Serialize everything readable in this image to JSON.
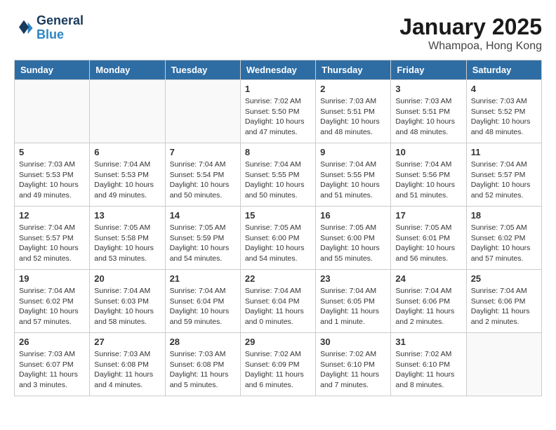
{
  "header": {
    "logo_line1": "General",
    "logo_line2": "Blue",
    "title": "January 2025",
    "subtitle": "Whampoa, Hong Kong"
  },
  "columns": [
    "Sunday",
    "Monday",
    "Tuesday",
    "Wednesday",
    "Thursday",
    "Friday",
    "Saturday"
  ],
  "weeks": [
    [
      {
        "day": "",
        "info": ""
      },
      {
        "day": "",
        "info": ""
      },
      {
        "day": "",
        "info": ""
      },
      {
        "day": "1",
        "info": "Sunrise: 7:02 AM\nSunset: 5:50 PM\nDaylight: 10 hours\nand 47 minutes."
      },
      {
        "day": "2",
        "info": "Sunrise: 7:03 AM\nSunset: 5:51 PM\nDaylight: 10 hours\nand 48 minutes."
      },
      {
        "day": "3",
        "info": "Sunrise: 7:03 AM\nSunset: 5:51 PM\nDaylight: 10 hours\nand 48 minutes."
      },
      {
        "day": "4",
        "info": "Sunrise: 7:03 AM\nSunset: 5:52 PM\nDaylight: 10 hours\nand 48 minutes."
      }
    ],
    [
      {
        "day": "5",
        "info": "Sunrise: 7:03 AM\nSunset: 5:53 PM\nDaylight: 10 hours\nand 49 minutes."
      },
      {
        "day": "6",
        "info": "Sunrise: 7:04 AM\nSunset: 5:53 PM\nDaylight: 10 hours\nand 49 minutes."
      },
      {
        "day": "7",
        "info": "Sunrise: 7:04 AM\nSunset: 5:54 PM\nDaylight: 10 hours\nand 50 minutes."
      },
      {
        "day": "8",
        "info": "Sunrise: 7:04 AM\nSunset: 5:55 PM\nDaylight: 10 hours\nand 50 minutes."
      },
      {
        "day": "9",
        "info": "Sunrise: 7:04 AM\nSunset: 5:55 PM\nDaylight: 10 hours\nand 51 minutes."
      },
      {
        "day": "10",
        "info": "Sunrise: 7:04 AM\nSunset: 5:56 PM\nDaylight: 10 hours\nand 51 minutes."
      },
      {
        "day": "11",
        "info": "Sunrise: 7:04 AM\nSunset: 5:57 PM\nDaylight: 10 hours\nand 52 minutes."
      }
    ],
    [
      {
        "day": "12",
        "info": "Sunrise: 7:04 AM\nSunset: 5:57 PM\nDaylight: 10 hours\nand 52 minutes."
      },
      {
        "day": "13",
        "info": "Sunrise: 7:05 AM\nSunset: 5:58 PM\nDaylight: 10 hours\nand 53 minutes."
      },
      {
        "day": "14",
        "info": "Sunrise: 7:05 AM\nSunset: 5:59 PM\nDaylight: 10 hours\nand 54 minutes."
      },
      {
        "day": "15",
        "info": "Sunrise: 7:05 AM\nSunset: 6:00 PM\nDaylight: 10 hours\nand 54 minutes."
      },
      {
        "day": "16",
        "info": "Sunrise: 7:05 AM\nSunset: 6:00 PM\nDaylight: 10 hours\nand 55 minutes."
      },
      {
        "day": "17",
        "info": "Sunrise: 7:05 AM\nSunset: 6:01 PM\nDaylight: 10 hours\nand 56 minutes."
      },
      {
        "day": "18",
        "info": "Sunrise: 7:05 AM\nSunset: 6:02 PM\nDaylight: 10 hours\nand 57 minutes."
      }
    ],
    [
      {
        "day": "19",
        "info": "Sunrise: 7:04 AM\nSunset: 6:02 PM\nDaylight: 10 hours\nand 57 minutes."
      },
      {
        "day": "20",
        "info": "Sunrise: 7:04 AM\nSunset: 6:03 PM\nDaylight: 10 hours\nand 58 minutes."
      },
      {
        "day": "21",
        "info": "Sunrise: 7:04 AM\nSunset: 6:04 PM\nDaylight: 10 hours\nand 59 minutes."
      },
      {
        "day": "22",
        "info": "Sunrise: 7:04 AM\nSunset: 6:04 PM\nDaylight: 11 hours\nand 0 minutes."
      },
      {
        "day": "23",
        "info": "Sunrise: 7:04 AM\nSunset: 6:05 PM\nDaylight: 11 hours\nand 1 minute."
      },
      {
        "day": "24",
        "info": "Sunrise: 7:04 AM\nSunset: 6:06 PM\nDaylight: 11 hours\nand 2 minutes."
      },
      {
        "day": "25",
        "info": "Sunrise: 7:04 AM\nSunset: 6:06 PM\nDaylight: 11 hours\nand 2 minutes."
      }
    ],
    [
      {
        "day": "26",
        "info": "Sunrise: 7:03 AM\nSunset: 6:07 PM\nDaylight: 11 hours\nand 3 minutes."
      },
      {
        "day": "27",
        "info": "Sunrise: 7:03 AM\nSunset: 6:08 PM\nDaylight: 11 hours\nand 4 minutes."
      },
      {
        "day": "28",
        "info": "Sunrise: 7:03 AM\nSunset: 6:08 PM\nDaylight: 11 hours\nand 5 minutes."
      },
      {
        "day": "29",
        "info": "Sunrise: 7:02 AM\nSunset: 6:09 PM\nDaylight: 11 hours\nand 6 minutes."
      },
      {
        "day": "30",
        "info": "Sunrise: 7:02 AM\nSunset: 6:10 PM\nDaylight: 11 hours\nand 7 minutes."
      },
      {
        "day": "31",
        "info": "Sunrise: 7:02 AM\nSunset: 6:10 PM\nDaylight: 11 hours\nand 8 minutes."
      },
      {
        "day": "",
        "info": ""
      }
    ]
  ]
}
